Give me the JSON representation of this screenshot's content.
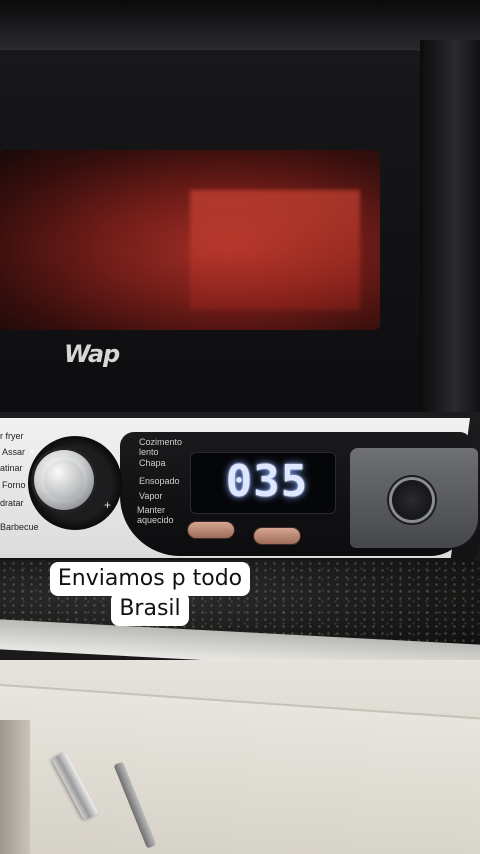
{
  "scene": {
    "brand_logo": "Wap",
    "control_panel": {
      "menu_labels": [
        "r fryer",
        "Assar",
        "atinar",
        "Forno",
        "dratar",
        "Barbecue"
      ],
      "mode_labels": [
        "Cozimento lento",
        "Chapa",
        "Ensopado",
        "Vapor",
        "Manter aquecido"
      ],
      "display_value": "035",
      "buttons": [
        "",
        ""
      ]
    }
  },
  "caption": {
    "line1": "Enviamos p todo",
    "line2": "Brasil"
  },
  "colors": {
    "caption_bg": "#ffffff",
    "caption_text": "#111111",
    "display_glow": "#7ea4ff",
    "oven_interior": "#b3322a"
  }
}
